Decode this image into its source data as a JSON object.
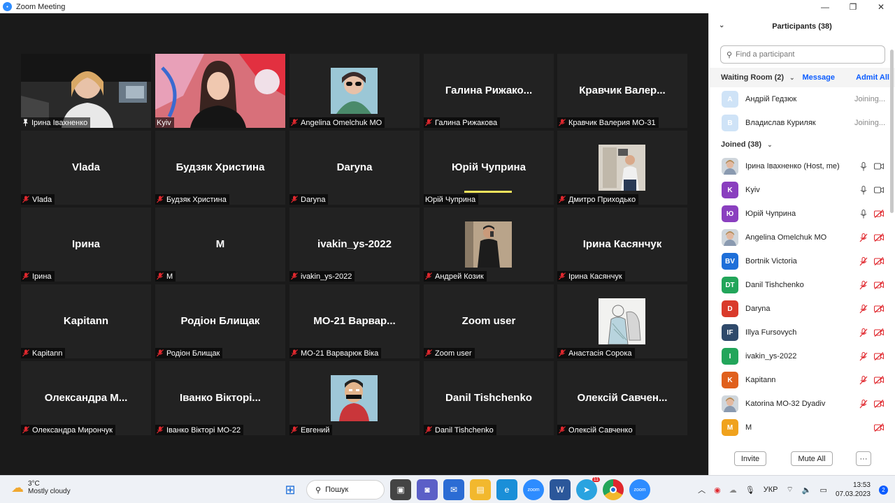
{
  "window": {
    "title": "Zoom Meeting",
    "minimize": "—",
    "maximize": "❐",
    "close": "✕"
  },
  "tiles": [
    {
      "label": "Ірина Івахненко",
      "big": "",
      "icon": "pin",
      "kind": "video1"
    },
    {
      "label": "Kyiv",
      "big": "",
      "icon": "none",
      "kind": "video2",
      "active": true
    },
    {
      "label": "Angelina Omelchuk MO",
      "big": "",
      "icon": "mute",
      "kind": "photo-sunglasses"
    },
    {
      "label": "Галина Рижакова",
      "big": "Галина Рижако...",
      "icon": "mute"
    },
    {
      "label": "Кравчик Валерия МО-31",
      "big": "Кравчик Валер...",
      "icon": "mute"
    },
    {
      "label": "Vlada",
      "big": "Vlada",
      "icon": "mute"
    },
    {
      "label": "Будзяк Христина",
      "big": "Будзяк Христина",
      "icon": "mute"
    },
    {
      "label": "Daryna",
      "big": "Daryna",
      "icon": "mute"
    },
    {
      "label": "Юрій Чуприна",
      "big": "Юрій Чуприна",
      "icon": "none"
    },
    {
      "label": "Дмитро Приходько",
      "big": "",
      "icon": "mute",
      "kind": "photo-man"
    },
    {
      "label": "Ірина",
      "big": "Ірина",
      "icon": "mute"
    },
    {
      "label": "М",
      "big": "М",
      "icon": "mute"
    },
    {
      "label": "ivakin_ys-2022",
      "big": "ivakin_ys-2022",
      "icon": "mute"
    },
    {
      "label": "Андрей Козик",
      "big": "",
      "icon": "mute",
      "kind": "photo-mirror"
    },
    {
      "label": "Ірина Касянчук",
      "big": "Ірина Касянчук",
      "icon": "mute"
    },
    {
      "label": "Kapitann",
      "big": "Kapitann",
      "icon": "mute"
    },
    {
      "label": "Родіон Блищак",
      "big": "Родіон Блищак",
      "icon": "mute"
    },
    {
      "label": "МО-21 Варварюк Віка",
      "big": "МО-21 Варвар...",
      "icon": "mute"
    },
    {
      "label": "Zoom user",
      "big": "Zoom user",
      "icon": "mute"
    },
    {
      "label": "Анастасія Сорока",
      "big": "",
      "icon": "mute",
      "kind": "photo-sketch"
    },
    {
      "label": "Олександра Мирончук",
      "big": "Олександра М...",
      "icon": "mute"
    },
    {
      "label": "Іванко Вікторі МО-22",
      "big": "Іванко Вікторі...",
      "icon": "mute"
    },
    {
      "label": "Евгений",
      "big": "",
      "icon": "mute",
      "kind": "photo-cartoon"
    },
    {
      "label": "Danil Tishchenko",
      "big": "Danil Tishchenko",
      "icon": "mute"
    },
    {
      "label": "Олексій Савченко",
      "big": "Олексій Савчен...",
      "icon": "mute"
    }
  ],
  "panel": {
    "title": "Participants (38)",
    "search_placeholder": "Find a participant",
    "waiting_label": "Waiting Room (2)",
    "message_label": "Message",
    "admit_all_label": "Admit All",
    "waiting": [
      {
        "initial": "А",
        "name": "Андрій Гедзюк",
        "status": "Joining..."
      },
      {
        "initial": "В",
        "name": "Владислав Куриляк",
        "status": "Joining..."
      }
    ],
    "joined_label": "Joined (38)",
    "joined": [
      {
        "initial": "",
        "name": "Ірина Івахненко (Host, me)",
        "color": "#d9b38c",
        "photo": true,
        "mic": "on",
        "cam": "on"
      },
      {
        "initial": "K",
        "name": "Kyiv",
        "color": "#8a3fbf",
        "mic": "on",
        "cam": "on"
      },
      {
        "initial": "Ю",
        "name": "Юрій Чуприна",
        "color": "#8a3fbf",
        "mic": "on",
        "cam": "off"
      },
      {
        "initial": "",
        "name": "Angelina Omelchuk MO",
        "color": "#9aa",
        "photo": true,
        "mic": "off",
        "cam": "off"
      },
      {
        "initial": "BV",
        "name": "Bortnik Victoria",
        "color": "#1e6fd9",
        "mic": "off",
        "cam": "off"
      },
      {
        "initial": "DT",
        "name": "Danil Tishchenko",
        "color": "#22a55a",
        "mic": "off",
        "cam": "off"
      },
      {
        "initial": "D",
        "name": "Daryna",
        "color": "#d93a2b",
        "mic": "off",
        "cam": "off"
      },
      {
        "initial": "IF",
        "name": "Illya Fursovych",
        "color": "#2f4a6b",
        "mic": "off",
        "cam": "off"
      },
      {
        "initial": "I",
        "name": "ivakin_ys-2022",
        "color": "#22a55a",
        "mic": "off",
        "cam": "off"
      },
      {
        "initial": "K",
        "name": "Kapitann",
        "color": "#e0601d",
        "mic": "off",
        "cam": "off"
      },
      {
        "initial": "",
        "name": "Katorina MO-32 Dyadiv",
        "color": "#b05050",
        "photo": true,
        "mic": "off",
        "cam": "off"
      },
      {
        "initial": "M",
        "name": "M",
        "color": "#f0a21d",
        "mic": "none",
        "cam": "off"
      }
    ],
    "invite_label": "Invite",
    "mute_all_label": "Mute All",
    "more_label": "···"
  },
  "taskbar": {
    "temperature": "3°C",
    "weather_text": "Mostly cloudy",
    "search_label": "Пошук",
    "language": "УКР",
    "time": "13:53",
    "date": "07.03.2023",
    "telegram_badge": "11",
    "notification_count": "2"
  },
  "colors": {
    "accent": "#0b5cff",
    "active_speaker": "#f5e45c",
    "mute_red": "#e0282e"
  }
}
